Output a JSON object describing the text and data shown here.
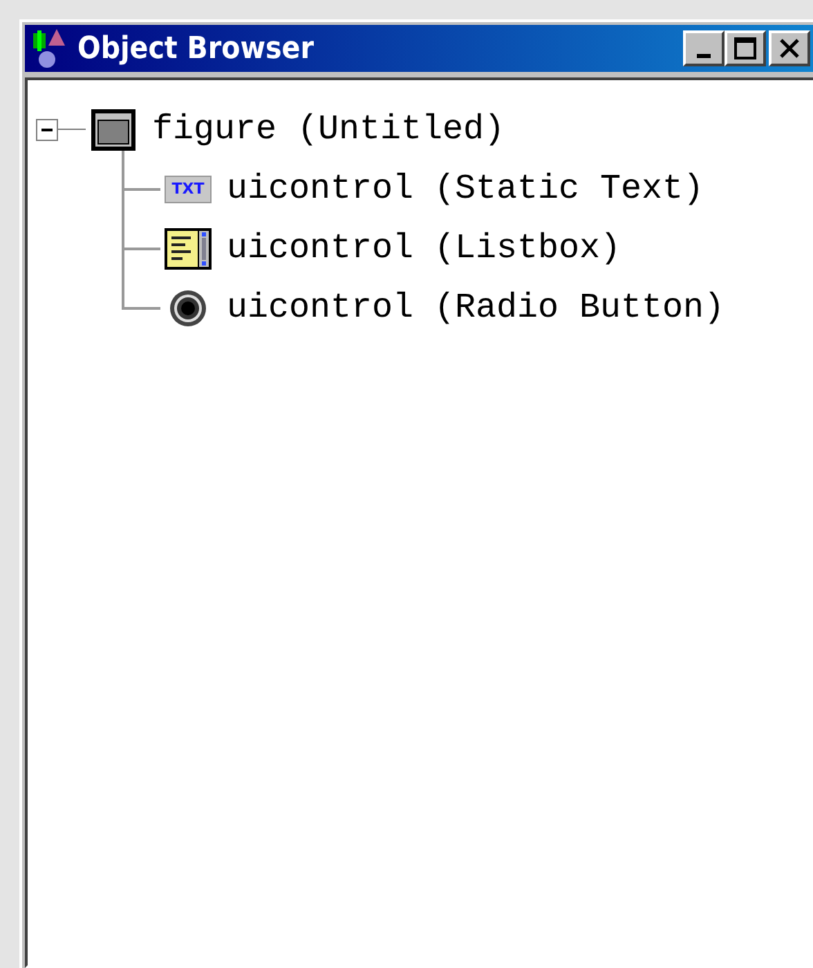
{
  "window": {
    "title": "Object Browser"
  },
  "tree": [
    {
      "kind": "figure",
      "label": "figure (Untitled)",
      "expanded": true,
      "children": [
        {
          "kind": "text",
          "icon_text": "TXT",
          "label": "uicontrol (Static Text)"
        },
        {
          "kind": "listbox",
          "label": "uicontrol (Listbox)"
        },
        {
          "kind": "radio",
          "label": "uicontrol (Radio Button)"
        }
      ]
    }
  ]
}
